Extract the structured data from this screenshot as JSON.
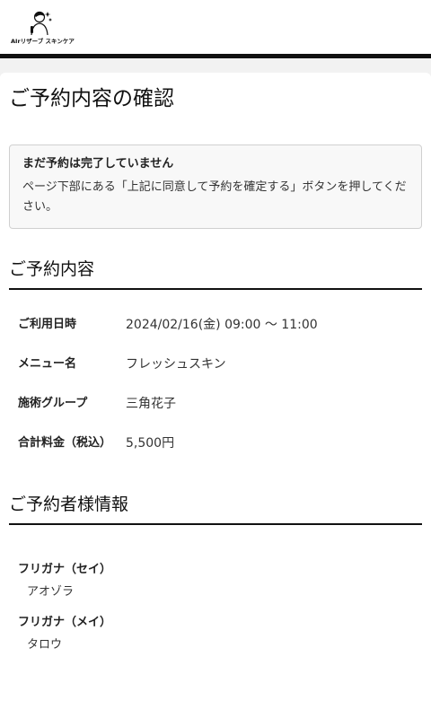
{
  "brand": {
    "logo_text": "AIrリザーブ スキンケア",
    "logo_icon": "woman-silhouette-icon"
  },
  "page": {
    "title": "ご予約内容の確認"
  },
  "notice": {
    "title": "まだ予約は完了していません",
    "body": "ページ下部にある「上記に同意して予約を確定する」ボタンを押してください。"
  },
  "reservation": {
    "heading": "ご予約内容",
    "rows": [
      {
        "label": "ご利用日時",
        "value": "2024/02/16(金) 09:00 〜 11:00"
      },
      {
        "label": "メニュー名",
        "value": "フレッシュスキン"
      },
      {
        "label": "施術グループ",
        "value": "三角花子"
      },
      {
        "label": "合計料金（税込）",
        "value": "5,500円"
      }
    ]
  },
  "customer": {
    "heading": "ご予約者様情報",
    "items": [
      {
        "label": "フリガナ（セイ）",
        "value": "アオゾラ"
      },
      {
        "label": "フリガナ（メイ）",
        "value": "タロウ"
      }
    ]
  }
}
